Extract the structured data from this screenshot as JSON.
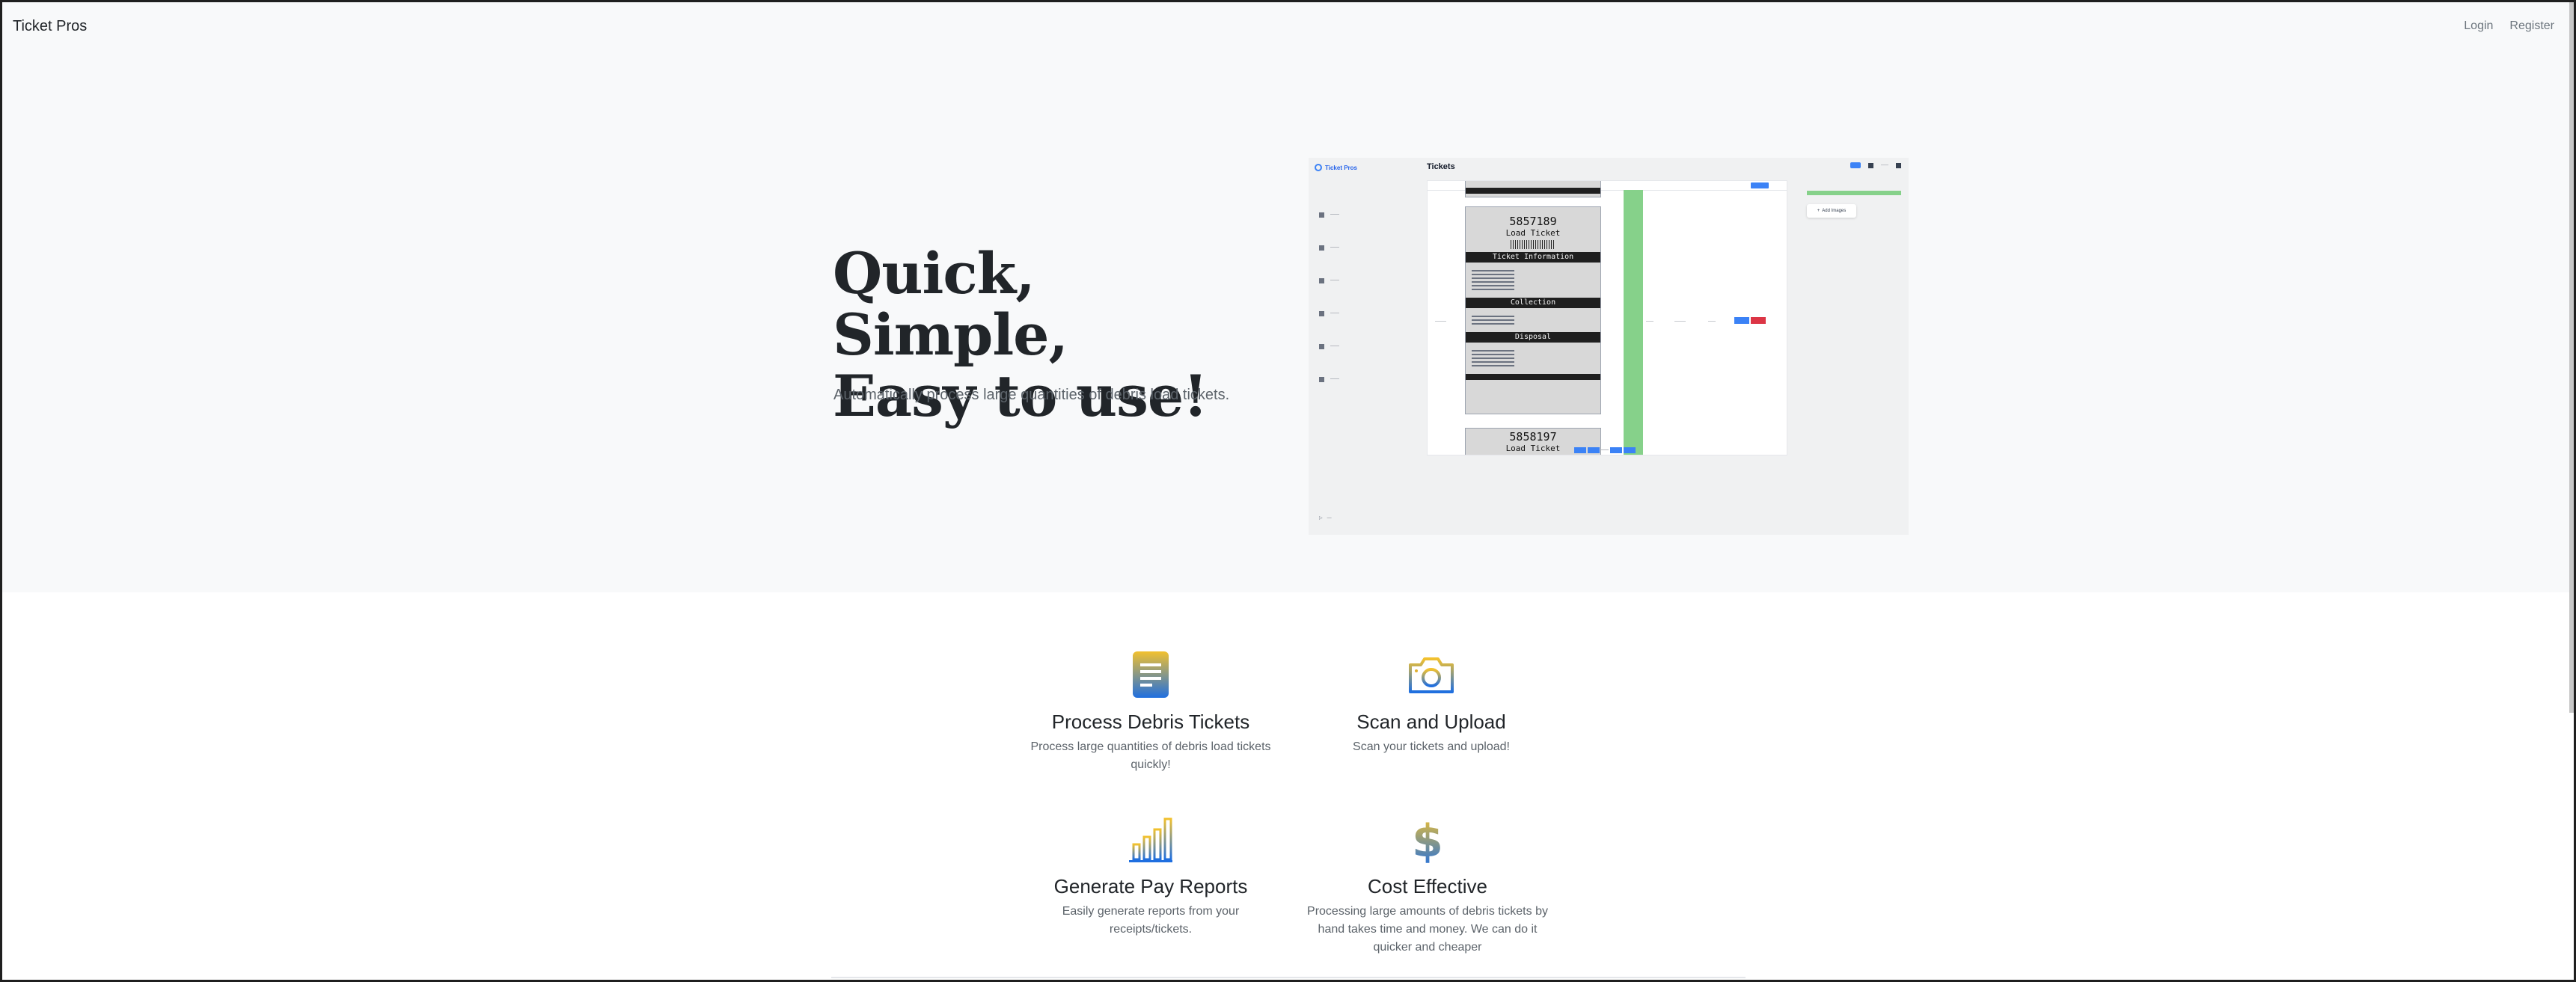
{
  "navbar": {
    "brand": "Ticket Pros",
    "login": "Login",
    "register": "Register"
  },
  "hero": {
    "title_line1": "Quick, Simple,",
    "title_line2": "Easy to use!",
    "subtitle": "Automatically process large quantities of debris load tickets."
  },
  "preview": {
    "brand": "Ticket Pros",
    "page_title": "Tickets",
    "ticket1_number": "5857189",
    "ticket1_label": "Load Ticket",
    "ticket1_band1": "Ticket Information",
    "ticket1_band2": "Collection",
    "ticket1_band3": "Disposal",
    "ticket2_number": "5858197",
    "ticket2_label": "Load Ticket",
    "add_images": "Add Images"
  },
  "features": [
    {
      "icon": "document-icon",
      "title": "Process Debris Tickets",
      "desc": "Process large quantities of debris load tickets quickly!"
    },
    {
      "icon": "camera-icon",
      "title": "Scan and Upload",
      "desc": "Scan your tickets and upload!"
    },
    {
      "icon": "bar-chart-icon",
      "title": "Generate Pay Reports",
      "desc": "Easily generate reports from your receipts/tickets."
    },
    {
      "icon": "dollar-icon",
      "title": "Cost Effective",
      "desc": "Processing large amounts of debris tickets by hand takes time and money. We can do it quicker and cheaper"
    }
  ],
  "colors": {
    "hero_bg": "#f8f9fa",
    "gradient_top": "#f2c12e",
    "gradient_bottom": "#1f6fe0"
  }
}
